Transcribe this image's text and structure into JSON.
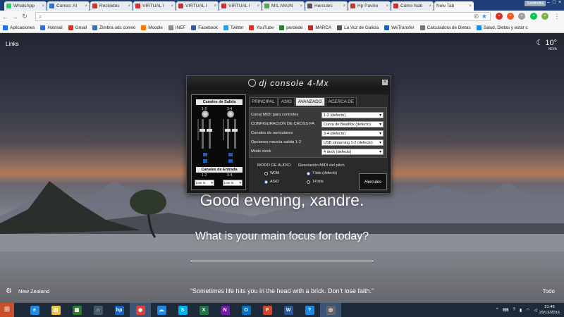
{
  "browser": {
    "tabs": [
      {
        "label": "WhatsApp",
        "color": "#25d366"
      },
      {
        "label": "Correo: Al",
        "color": "#2f6fd6"
      },
      {
        "label": "Recibidos",
        "color": "#d93025"
      },
      {
        "label": "VIRTUAL I",
        "color": "#d32f2f"
      },
      {
        "label": "VIRTUAL I",
        "color": "#d32f2f"
      },
      {
        "label": "VIRTUAL I",
        "color": "#d32f2f"
      },
      {
        "label": "MIL ANUN",
        "color": "#4caf50"
      },
      {
        "label": "Hercules",
        "color": "#555555"
      },
      {
        "label": "Hp Pavilio",
        "color": "#d32f2f"
      },
      {
        "label": "Cómo Nab",
        "color": "#d32f2f"
      }
    ],
    "active_tab": "New Tab",
    "user_chip": "Xandrelles",
    "omnibox_value": ""
  },
  "bookmarks": [
    {
      "label": "Aplicaciones",
      "color": "#1a73e8"
    },
    {
      "label": "Hotmail",
      "color": "#2f6fd6"
    },
    {
      "label": "Gmail",
      "color": "#d93025"
    },
    {
      "label": "Zimbra udc correo",
      "color": "#3b6fb6"
    },
    {
      "label": "Moodle",
      "color": "#f57c00"
    },
    {
      "label": "INEF",
      "color": "#888888"
    },
    {
      "label": "Facebook",
      "color": "#3b5998"
    },
    {
      "label": "Twitter",
      "color": "#1da1f2"
    },
    {
      "label": "YouTube",
      "color": "#e52d27"
    },
    {
      "label": "pordede",
      "color": "#2e7d32"
    },
    {
      "label": "MARCA",
      "color": "#c62828"
    },
    {
      "label": "La Voz de Galicia",
      "color": "#555555"
    },
    {
      "label": "WeTransfer",
      "color": "#1565c0"
    },
    {
      "label": "Calculadora de Dietas",
      "color": "#777777"
    },
    {
      "label": "Salud, Dietas y estar c",
      "color": "#1e88e5"
    }
  ],
  "momentum": {
    "links": "Links",
    "temperature": "10°",
    "weather_loc": "NOIA",
    "greeting": "Good evening, xandre.",
    "focus_question": "What is your main focus for today?",
    "location": "New Zealand",
    "quote": "“Sometimes life hits you in the head with a brick. Don’t lose faith.”",
    "todo": "Todo"
  },
  "dj_console": {
    "title": "dj console 4-Mx",
    "output_header": "Canales de Salida",
    "output_left": "1-2",
    "output_right": "3-4",
    "input_header": "Canales de Entrada",
    "input_left": "1-2",
    "input_right": "3-4",
    "input_select_left": "Line in",
    "input_select_right": "Line in",
    "tabs": [
      "PRINCIPAL",
      "ASIO",
      "AVANZADO",
      "ACERCA DE"
    ],
    "active_tab": "AVANZADO",
    "settings": [
      {
        "label": "Canal MIDI para controles",
        "value": "1-2 (defecto)"
      },
      {
        "label": "CONFIGURACIÓN DE CROSS FA",
        "value": "Curva de BeatMix (defecto)"
      },
      {
        "label": "Canales de auriculares",
        "value": "3-4 (defecto)"
      },
      {
        "label": "Opciones mezcla salida 1-2",
        "value": "USB streaming 1-2 (defecto)"
      },
      {
        "label": "Modo deck",
        "value": "4 deck (defecto)"
      }
    ],
    "audio_mode_title": "MODO DE AUDIO",
    "audio_mode_options": [
      "WDM",
      "ASIO"
    ],
    "midi_res_title": "Resolución MIDI del pitch",
    "midi_res_options": [
      "7 bits (defecto)",
      "14 bits"
    ],
    "brand": "Hercules"
  },
  "taskbar": {
    "apps": [
      {
        "name": "ie",
        "glyph": "e",
        "color": "#1e88e5"
      },
      {
        "name": "explorer",
        "glyph": "▤",
        "color": "#f0c040"
      },
      {
        "name": "store",
        "glyph": "▦",
        "color": "#2e7d32"
      },
      {
        "name": "home",
        "glyph": "⌂",
        "color": "#455a64"
      },
      {
        "name": "hp",
        "glyph": "hp",
        "color": "#1565c0"
      },
      {
        "name": "chrome",
        "glyph": "◉",
        "color": "#db4437"
      },
      {
        "name": "onedrive",
        "glyph": "☁",
        "color": "#1e88e5"
      },
      {
        "name": "skype",
        "glyph": "S",
        "color": "#00aff0"
      },
      {
        "name": "excel",
        "glyph": "X",
        "color": "#217346"
      },
      {
        "name": "onenote",
        "glyph": "N",
        "color": "#7719aa"
      },
      {
        "name": "outlook",
        "glyph": "O",
        "color": "#0072c6"
      },
      {
        "name": "powerpoint",
        "glyph": "P",
        "color": "#d24726"
      },
      {
        "name": "word",
        "glyph": "W",
        "color": "#2b579a"
      },
      {
        "name": "help",
        "glyph": "?",
        "color": "#1e88e5"
      },
      {
        "name": "dj-console",
        "glyph": "◎",
        "color": "#666666"
      }
    ],
    "time": "21:46",
    "date": "25/12/2016"
  }
}
